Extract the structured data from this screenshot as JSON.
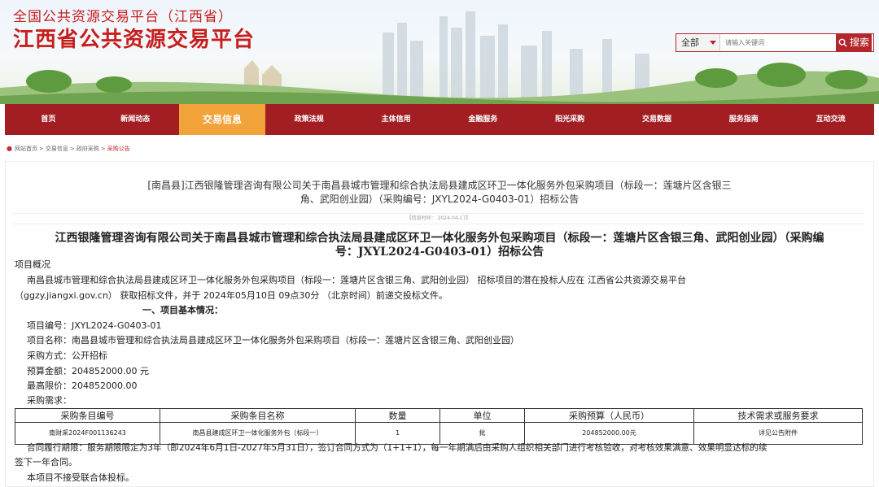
{
  "header": {
    "subtitle": "全国公共资源交易平台（江西省）",
    "title": "江西省公共资源交易平台",
    "search": {
      "category": "全部",
      "placeholder": "请输入关键词",
      "button": "搜索"
    }
  },
  "nav": {
    "items": [
      "首页",
      "新闻动态",
      "交易信息",
      "政策法规",
      "主体信用",
      "金融服务",
      "阳光采购",
      "交易数据",
      "服务指南",
      "互动交流"
    ],
    "active": "交易信息"
  },
  "breadcrumb": {
    "items": [
      "网站首页",
      "交易信息",
      "政府采购",
      "采购公告"
    ]
  },
  "article": {
    "header_title_line1": "[南昌县]江西银隆管理咨询有限公司关于南昌县城市管理和综合执法局县建成区环卫一体化服务外包采购项目（标段一：莲塘片区含银三",
    "header_title_line2": "角、武阳创业园）（采购编号：JXYL2024-G0403-01）招标公告",
    "publish_date": "【信息时间： 2024-04-17】",
    "main_title_line1": "江西银隆管理咨询有限公司关于南昌县城市管理和综合执法局县建成区环卫一体化服务外包采购项目（标段一：莲塘片区含银三角、武阳创业园）（采购编",
    "main_title_line2": "号：JXYL2024-G0403-01）招标公告",
    "section_overview": "项目概况",
    "overview_line1": "南昌县城市管理和综合执法局县建成区环卫一体化服务外包采购项目（标段一：莲塘片区含银三角、武阳创业园） 招标项目的潜在投标人应在 江西省公共资源交易平台",
    "overview_line2": "（ggzy.jiangxi.gov.cn） 获取招标文件，并于 2024年05月10日 09点30分 （北京时间）前递交投标文件。",
    "section_basic": "一、项目基本情况：",
    "project_no": "项目编号：JXYL2024-G0403-01",
    "project_name": "项目名称：南昌县城市管理和综合执法局县建成区环卫一体化服务外包采购项目（标段一：莲塘片区含银三角、武阳创业园）",
    "method": "采购方式：公开招标",
    "budget": "预算金额：204852000.00 元",
    "max_price": "最高限价：204852000.00",
    "requirements_label": "采购需求：",
    "table": {
      "headers": [
        "采购条目编号",
        "采购条目名称",
        "数量",
        "单位",
        "采购预算（人民币）",
        "技术需求或服务要求"
      ],
      "rows": [
        [
          "南财采2024F001136243",
          "南昌县建成区环卫一体化服务外包（标段一）",
          "1",
          "批",
          "204852000.00元",
          "详见公告附件"
        ]
      ]
    },
    "contract_line1": "合同履行期限：服务期限限定为3年（即2024年6月1日-2027年5月31日），签订合同方式为（1+1+1），每一年期满后由采购人组织相关部门进行考核验收，对考核效果满意、效果明显达标的续",
    "contract_line2": "签下一年合同。",
    "consortium": "本项目不接受联合体投标。"
  }
}
